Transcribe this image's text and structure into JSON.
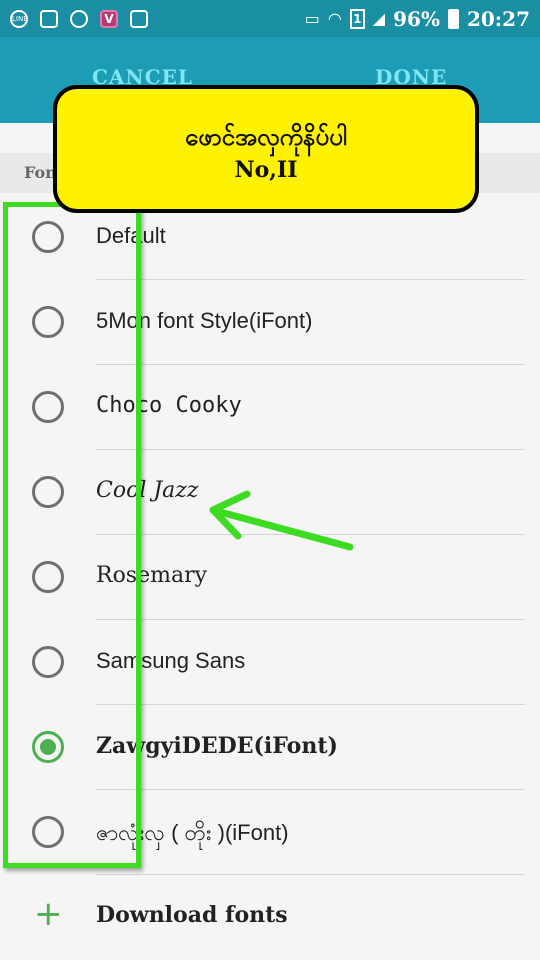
{
  "status_bar": {
    "icons": [
      "line-icon",
      "image-icon",
      "camera-icon",
      "v-app-icon",
      "clipboard-check-icon"
    ],
    "v_icon_letter": "V",
    "line_icon_text": "LINE",
    "sim_slot": "1",
    "battery": "96%",
    "time": "20:27",
    "colors": {
      "background": "#1a8ea3"
    }
  },
  "app_bar": {
    "cancel_label": "CANCEL",
    "done_label": "DONE",
    "colors": {
      "background": "#1d9cb5",
      "text": "#7fe6f3"
    }
  },
  "section": {
    "header_label": "Font"
  },
  "fonts": [
    {
      "label": "Default",
      "selected": false
    },
    {
      "label": "5Mon font Style(iFont)",
      "selected": false
    },
    {
      "label": "Choco Cooky",
      "selected": false
    },
    {
      "label": "Cool Jazz",
      "selected": false
    },
    {
      "label": "Rosemary",
      "selected": false
    },
    {
      "label": "Samsung Sans",
      "selected": false
    },
    {
      "label": "ZawgyiDEDE(iFont)",
      "selected": true
    },
    {
      "label": "ဇာလုံးလှ ( တိုး )(iFont)",
      "selected": false
    }
  ],
  "download": {
    "plus": "+",
    "label": "Download fonts"
  },
  "annotation": {
    "title": "ဖောင်အလှကိုနိပ်ပါ",
    "subtitle": "No,II",
    "colors": {
      "callout": "#fff200",
      "box": "#3ddc22",
      "arrow": "#3ddc22"
    }
  }
}
